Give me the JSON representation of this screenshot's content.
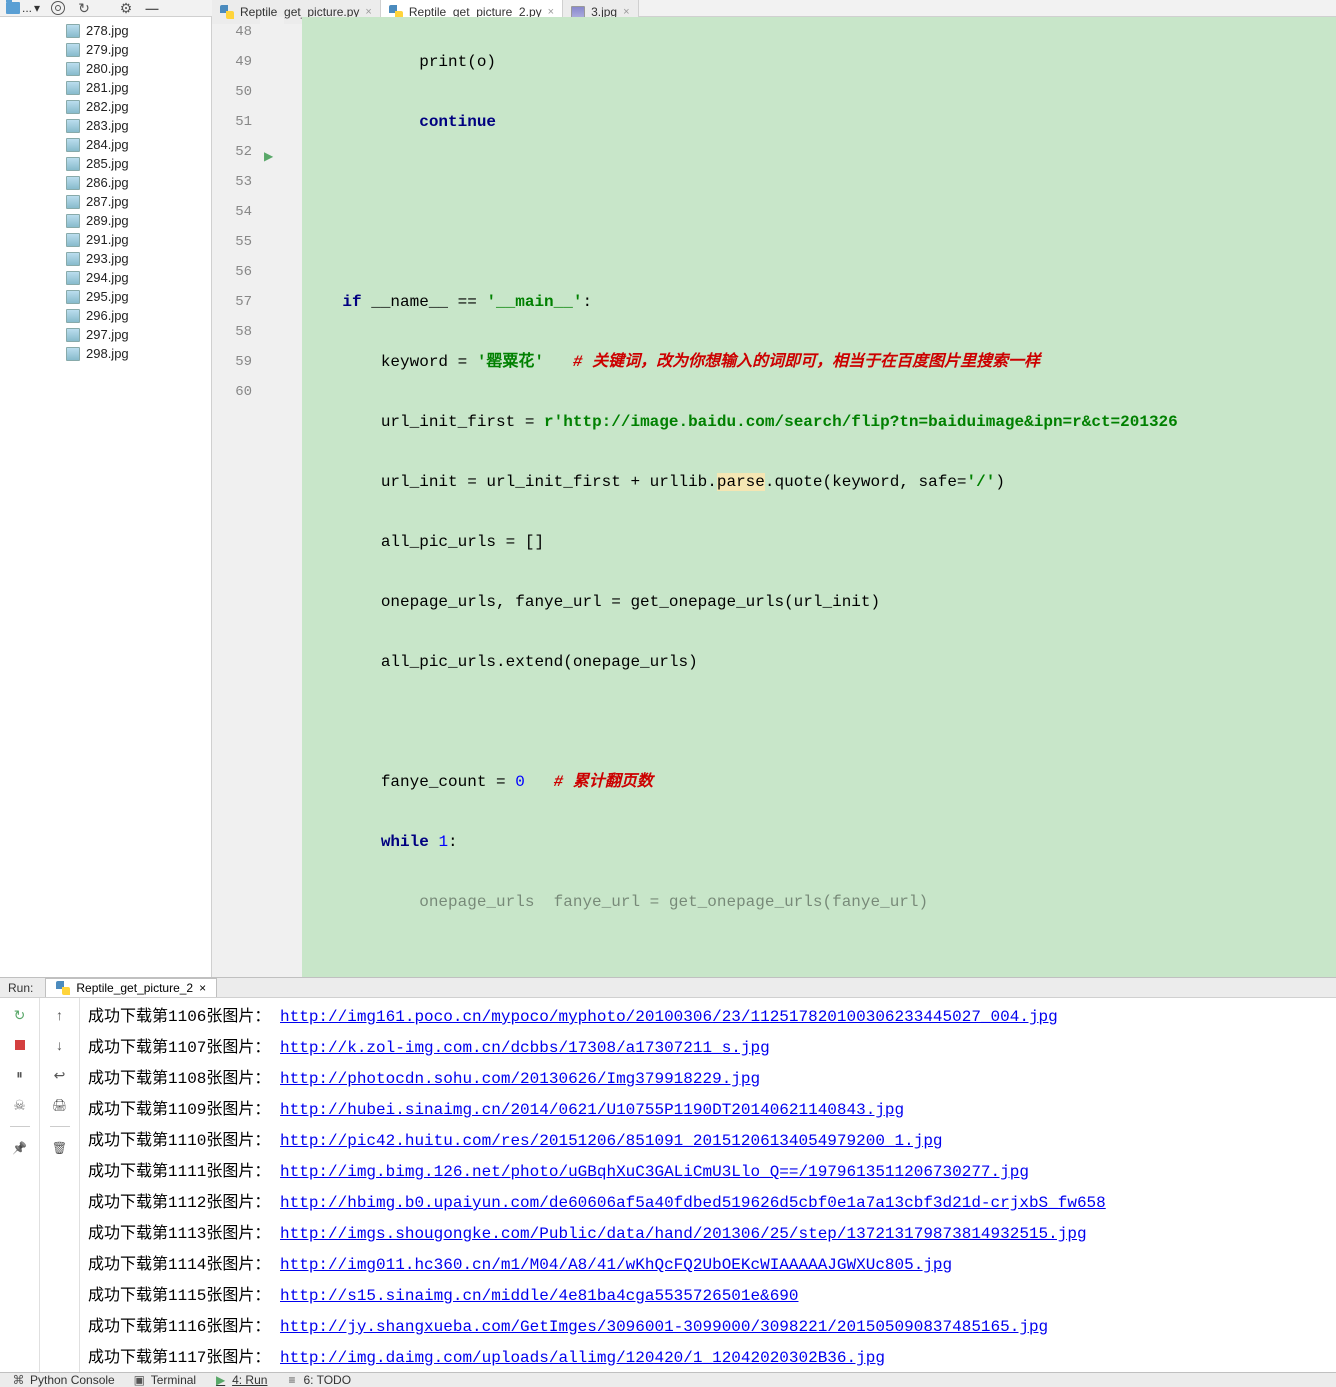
{
  "toolbar": {
    "combo": "..."
  },
  "tabs": [
    {
      "label": "Reptile_get_picture.py",
      "type": "py",
      "active": false
    },
    {
      "label": "Reptile_get_picture_2.py",
      "type": "py",
      "active": true
    },
    {
      "label": "3.jpg",
      "type": "img",
      "active": false
    }
  ],
  "files": [
    "278.jpg",
    "279.jpg",
    "280.jpg",
    "281.jpg",
    "282.jpg",
    "283.jpg",
    "284.jpg",
    "285.jpg",
    "286.jpg",
    "287.jpg",
    "289.jpg",
    "291.jpg",
    "293.jpg",
    "294.jpg",
    "295.jpg",
    "296.jpg",
    "297.jpg",
    "298.jpg"
  ],
  "gutter": [
    "",
    "48",
    "49",
    "50",
    "51",
    "52",
    "53",
    "54",
    "55",
    "56",
    "57",
    "58",
    "59",
    "60",
    ""
  ],
  "code": {
    "l0_a": "            print(o)",
    "l1_a": "            ",
    "l1_kw": "continue",
    "l4_a": "    ",
    "l4_kw": "if",
    "l4_b": " __name__ == ",
    "l4_s": "'__main__'",
    "l4_c": ":",
    "l5_a": "        keyword = ",
    "l5_s": "'罂粟花'",
    "l5_b": "   ",
    "l5_c": "# 关键词，改为你想输入的词即可，相当于在百度图片里搜索一样",
    "l6_a": "        url_init_first = ",
    "l6_r": "r",
    "l6_s": "'http://image.baidu.com/search/flip?tn=baiduimage&ipn=r&ct=201326",
    "l7_a": "        url_init = url_init_first + urllib.",
    "l7_p": "parse",
    "l7_b": ".quote(keyword, safe=",
    "l7_s": "'/'",
    "l7_c": ")",
    "l8_a": "        all_pic_urls = []",
    "l9_a": "        onepage_urls, fanye_url = get_onepage_urls(url_init)",
    "l10_a": "        all_pic_urls.extend(onepage_urls)",
    "l12_a": "        fanye_count = ",
    "l12_n": "0",
    "l12_b": "   ",
    "l12_c": "# 累计翻页数",
    "l13_a": "        ",
    "l13_kw": "while",
    "l13_b": " ",
    "l13_n": "1",
    "l13_c": ":",
    "l14_a": "            onepage_urls  fanye_url = get_onepage_urls(fanye_url)"
  },
  "run": {
    "title": "Run:",
    "tab": "Reptile_get_picture_2",
    "lines": [
      {
        "n": 1106,
        "u": "http://img161.poco.cn/mypoco/myphoto/20100306/23/11251782010030623344502​7_004.jpg"
      },
      {
        "n": 1107,
        "u": "http://k.zol-img.com.cn/dcbbs/17308/a17307211_s.jpg"
      },
      {
        "n": 1108,
        "u": "http://photocdn.sohu.com/20130626/Img379918229.jpg"
      },
      {
        "n": 1109,
        "u": "http://hubei.sinaimg.cn/2014/0621/U10755P1190DT20140621140843.jpg"
      },
      {
        "n": 1110,
        "u": "http://pic42.huitu.com/res/20151206/851091_20151206134054979200_1.jpg"
      },
      {
        "n": 1111,
        "u": "http://img.bimg.126.net/photo/uGBqhXuC3GALiCmU3Llo_Q==/1979613511206730277.jpg"
      },
      {
        "n": 1112,
        "u": "http://hbimg.b0.upaiyun.com/de60606af5a40fdbed519626d5cbf0e1a7a13cbf3d21d-crjxbS_fw658"
      },
      {
        "n": 1113,
        "u": "http://imgs.shougongke.com/Public/data/hand/201306/25/step/13721317987381​4932515.jpg"
      },
      {
        "n": 1114,
        "u": "http://img011.hc360.cn/m1/M04/A8/41/wKhQcFQ2UbOEKcWIAAAAAJGWXUc805.jpg"
      },
      {
        "n": 1115,
        "u": "http://s15.sinaimg.cn/middle/4e81ba4cga5535726501e&690"
      },
      {
        "n": 1116,
        "u": "http://jy.shangxueba.com/GetImges/3096001-3099000/3098221/201505090837485165.jpg"
      },
      {
        "n": 1117,
        "u": "http://img.daimg.com/uploads/allimg/120420/1_12042020302B36.jpg"
      }
    ],
    "prefix_a": "成功下载第",
    "prefix_b": "张图片："
  },
  "bottom": {
    "python_console": "Python Console",
    "terminal": "Terminal",
    "run": "4: Run",
    "todo": "6: TODO"
  }
}
